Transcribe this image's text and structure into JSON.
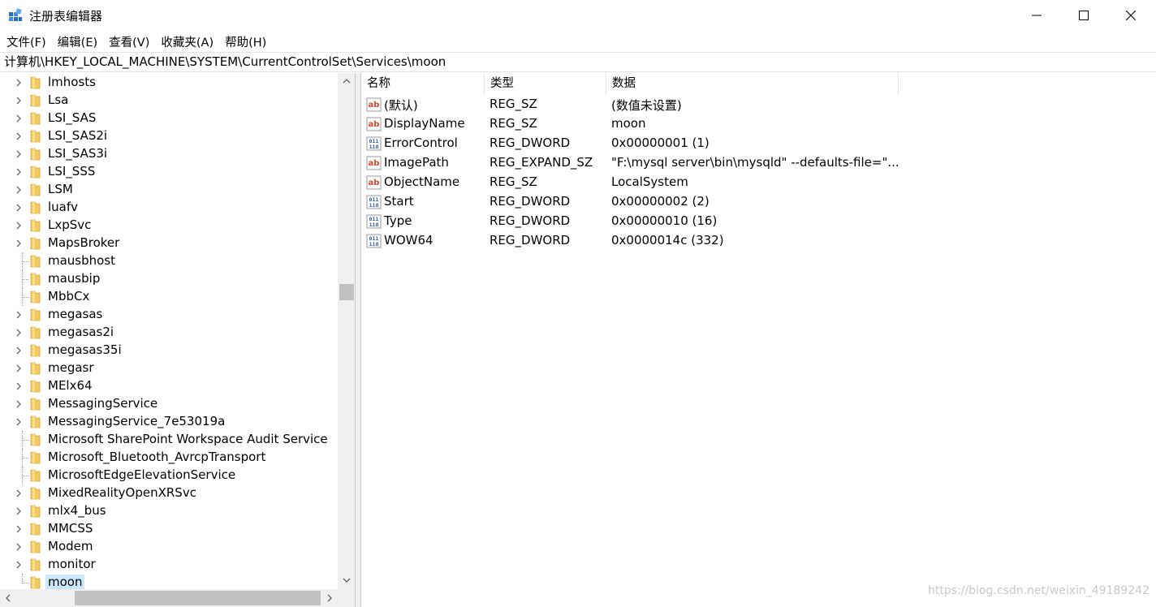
{
  "window": {
    "title": "注册表编辑器"
  },
  "menu": [
    "文件(F)",
    "编辑(E)",
    "查看(V)",
    "收藏夹(A)",
    "帮助(H)"
  ],
  "address": "计算机\\HKEY_LOCAL_MACHINE\\SYSTEM\\CurrentControlSet\\Services\\moon",
  "tree": {
    "items": [
      {
        "label": "lmhosts",
        "expandable": true
      },
      {
        "label": "Lsa",
        "expandable": true
      },
      {
        "label": "LSI_SAS",
        "expandable": true
      },
      {
        "label": "LSI_SAS2i",
        "expandable": true
      },
      {
        "label": "LSI_SAS3i",
        "expandable": true
      },
      {
        "label": "LSI_SSS",
        "expandable": true
      },
      {
        "label": "LSM",
        "expandable": true
      },
      {
        "label": "luafv",
        "expandable": true
      },
      {
        "label": "LxpSvc",
        "expandable": true
      },
      {
        "label": "MapsBroker",
        "expandable": true
      },
      {
        "label": "mausbhost",
        "expandable": false
      },
      {
        "label": "mausbip",
        "expandable": false
      },
      {
        "label": "MbbCx",
        "expandable": false
      },
      {
        "label": "megasas",
        "expandable": true
      },
      {
        "label": "megasas2i",
        "expandable": true
      },
      {
        "label": "megasas35i",
        "expandable": true
      },
      {
        "label": "megasr",
        "expandable": true
      },
      {
        "label": "MElx64",
        "expandable": true
      },
      {
        "label": "MessagingService",
        "expandable": true
      },
      {
        "label": "MessagingService_7e53019a",
        "expandable": true
      },
      {
        "label": "Microsoft SharePoint Workspace Audit Service",
        "expandable": false
      },
      {
        "label": "Microsoft_Bluetooth_AvrcpTransport",
        "expandable": false
      },
      {
        "label": "MicrosoftEdgeElevationService",
        "expandable": false
      },
      {
        "label": "MixedRealityOpenXRSvc",
        "expandable": true
      },
      {
        "label": "mlx4_bus",
        "expandable": true
      },
      {
        "label": "MMCSS",
        "expandable": true
      },
      {
        "label": "Modem",
        "expandable": true
      },
      {
        "label": "monitor",
        "expandable": true
      },
      {
        "label": "moon",
        "expandable": false,
        "selected": true
      }
    ]
  },
  "values": {
    "headers": {
      "name": "名称",
      "type": "类型",
      "data": "数据"
    },
    "rows": [
      {
        "name": "(默认)",
        "type": "REG_SZ",
        "data": "(数值未设置)",
        "icon": "string-value-icon"
      },
      {
        "name": "DisplayName",
        "type": "REG_SZ",
        "data": "moon",
        "icon": "string-value-icon"
      },
      {
        "name": "ErrorControl",
        "type": "REG_DWORD",
        "data": "0x00000001 (1)",
        "icon": "binary-value-icon"
      },
      {
        "name": "ImagePath",
        "type": "REG_EXPAND_SZ",
        "data": "\"F:\\mysql server\\bin\\mysqld\" --defaults-file=\"...",
        "icon": "string-value-icon"
      },
      {
        "name": "ObjectName",
        "type": "REG_SZ",
        "data": "LocalSystem",
        "icon": "string-value-icon"
      },
      {
        "name": "Start",
        "type": "REG_DWORD",
        "data": "0x00000002 (2)",
        "icon": "binary-value-icon"
      },
      {
        "name": "Type",
        "type": "REG_DWORD",
        "data": "0x00000010 (16)",
        "icon": "binary-value-icon"
      },
      {
        "name": "WOW64",
        "type": "REG_DWORD",
        "data": "0x0000014c (332)",
        "icon": "binary-value-icon"
      }
    ]
  },
  "watermark": "https://blog.csdn.net/weixin_49189242",
  "colors": {
    "selection": "#cce8ff",
    "folder": "#f4c85a",
    "scrollbar_thumb": "#c2c2c2",
    "string_icon": "#d9452f",
    "binary_icon": "#2b5aa8"
  }
}
